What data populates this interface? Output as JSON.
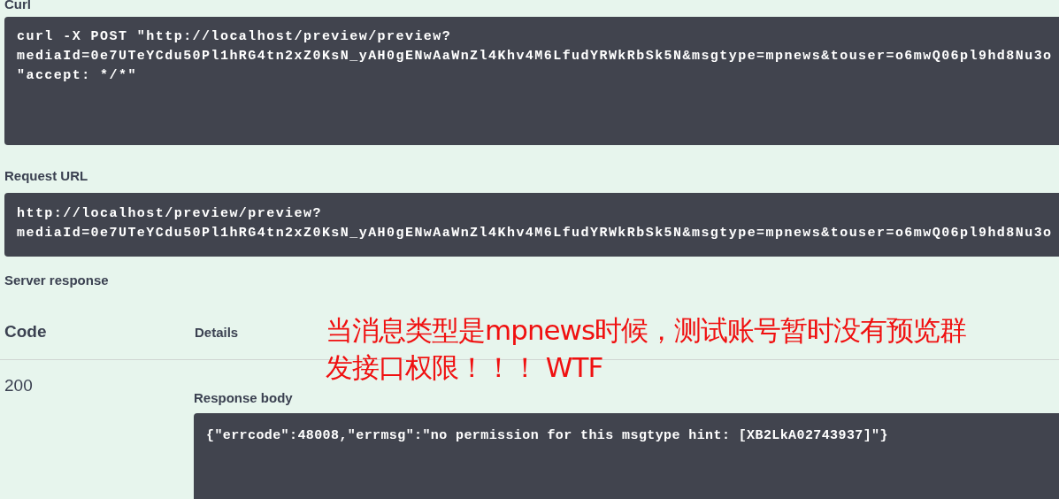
{
  "curl": {
    "label": "Curl",
    "lines": [
      "curl -X POST \"http://localhost/preview/preview?",
      "mediaId=0e7UTeYCdu50Pl1hRG4tn2xZ0KsN_yAH0gENwAaWnZl4Khv4M6LfudYRWkRbSk5N&msgtype=mpnews&touser=o6mwQ06pl9hd8Nu3o",
      "\"accept: */*\""
    ]
  },
  "request_url": {
    "label": "Request URL",
    "lines": [
      "http://localhost/preview/preview?",
      "mediaId=0e7UTeYCdu50Pl1hRG4tn2xZ0KsN_yAH0gENwAaWnZl4Khv4M6LfudYRWkRbSk5N&msgtype=mpnews&touser=o6mwQ06pl9hd8Nu3o"
    ]
  },
  "server_response": {
    "label": "Server response",
    "columns": [
      "Code",
      "Details"
    ],
    "rows": [
      {
        "code": "200",
        "body_label": "Response body",
        "body": "{\"errcode\":48008,\"errmsg\":\"no permission for this msgtype hint: [XB2LkA02743937]\"}"
      }
    ]
  },
  "annotation": {
    "lines": [
      "当消息类型是mpnews时候，测试账号暂时没有预览群",
      "发接口权限！！！ WTF"
    ]
  }
}
